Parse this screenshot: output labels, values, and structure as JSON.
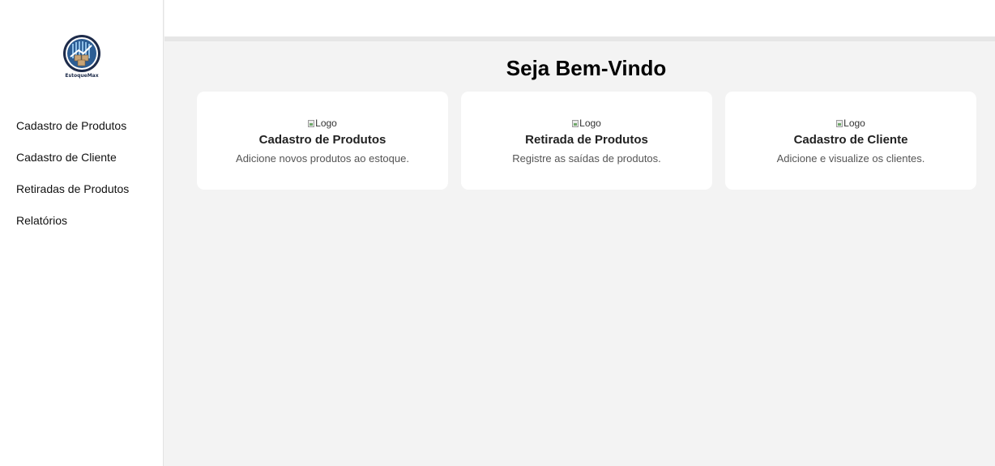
{
  "brand": {
    "name": "EstoqueMax"
  },
  "sidebar": {
    "items": [
      {
        "label": "Cadastro de Produtos"
      },
      {
        "label": "Cadastro de Cliente"
      },
      {
        "label": "Retiradas de Produtos"
      },
      {
        "label": "Relatórios"
      }
    ]
  },
  "main": {
    "title": "Seja Bem-Vindo",
    "cards": [
      {
        "img_alt": "Logo",
        "title": "Cadastro de Produtos",
        "description": "Adicione novos produtos ao estoque."
      },
      {
        "img_alt": "Logo",
        "title": "Retirada de Produtos",
        "description": "Registre as saídas de produtos."
      },
      {
        "img_alt": "Logo",
        "title": "Cadastro de Cliente",
        "description": "Adicione e visualize os clientes."
      }
    ]
  },
  "colors": {
    "sidebar_bg": "#ffffff",
    "page_bg": "#f3f3f3",
    "card_bg": "#ffffff",
    "logo_navy": "#1d2b4a",
    "logo_blue": "#3a7bbf"
  },
  "icons": {
    "logo": "warehouse-boxes-logo-icon",
    "broken_image": "broken-image-icon"
  }
}
